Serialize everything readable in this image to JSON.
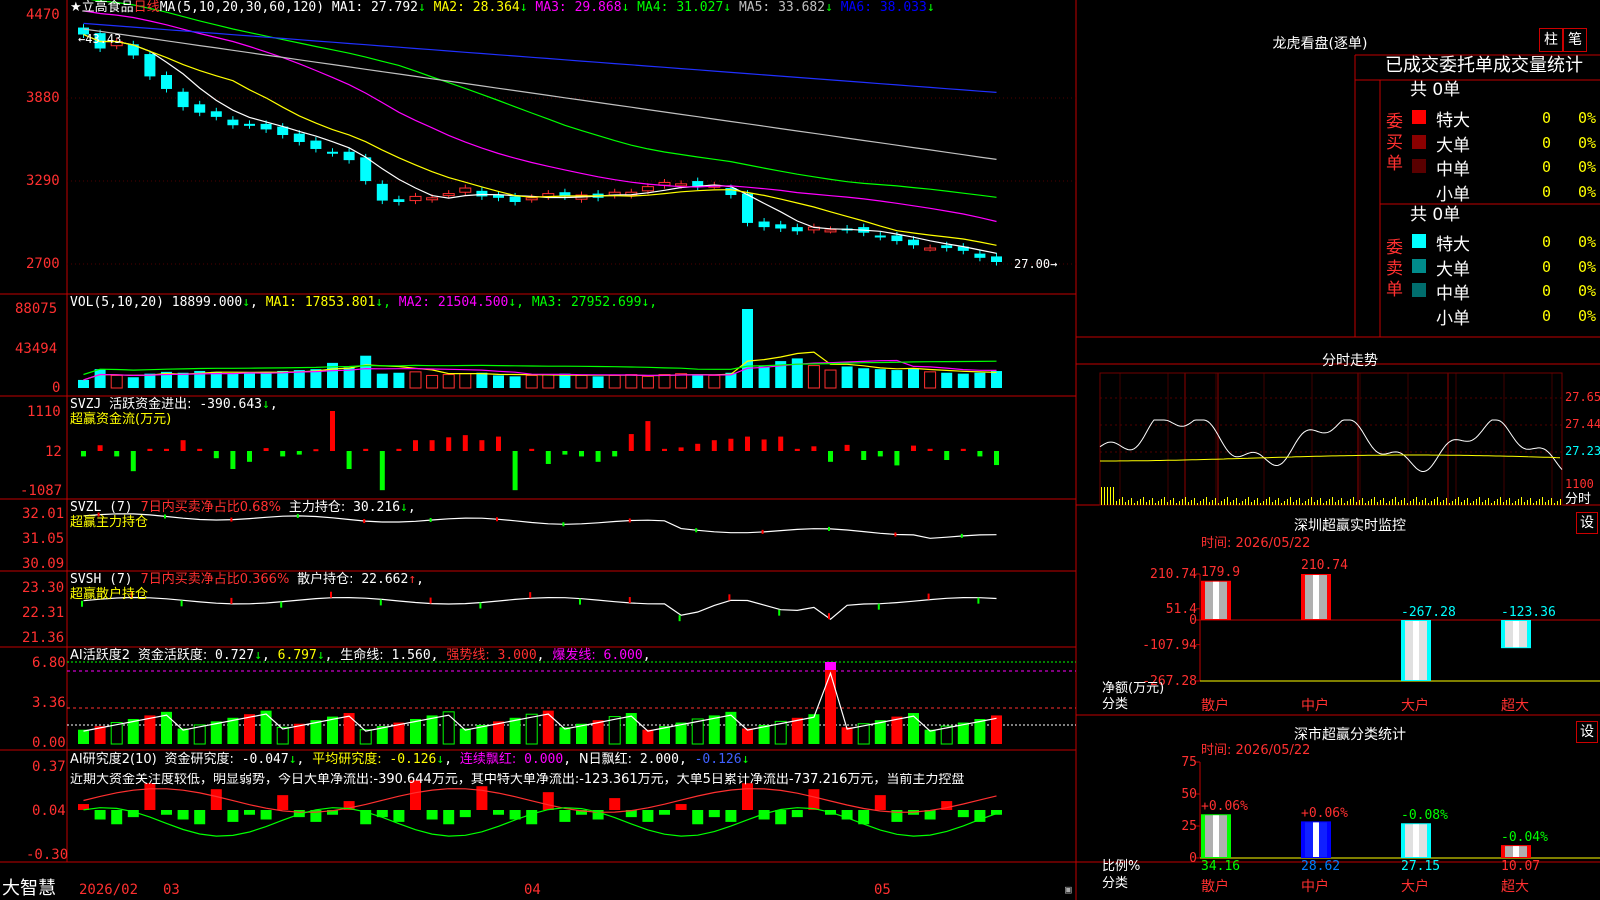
{
  "stock": {
    "name": "立高食品",
    "period": "日线",
    "ma_header": "MA(5,10,20,30,60,120)",
    "ma_values": [
      {
        "label": "MA1:",
        "value": "27.792",
        "arrow": "↓",
        "color": "#ffffff"
      },
      {
        "label": "MA2:",
        "value": "28.364",
        "arrow": "↓",
        "color": "#ffff00"
      },
      {
        "label": "MA3:",
        "value": "29.868",
        "arrow": "↓",
        "color": "#ff00ff"
      },
      {
        "label": "MA4:",
        "value": "31.027",
        "arrow": "↓",
        "color": "#00ff00"
      },
      {
        "label": "MA5:",
        "value": "33.682",
        "arrow": "↓",
        "color": "#c0c0c0"
      },
      {
        "label": "MA6:",
        "value": "38.033",
        "arrow": "↓",
        "color": "#0000ff"
      }
    ],
    "price_axis": [
      "4470",
      "3880",
      "3290",
      "2700"
    ],
    "high_label": "43.43",
    "last_label": "27.00"
  },
  "volume": {
    "header": "VOL(5,10,20)",
    "current": "18899.000",
    "ma": [
      {
        "label": "MA1:",
        "value": "17853.801",
        "color": "#ffff00"
      },
      {
        "label": "MA2:",
        "value": "21504.500",
        "color": "#ff00ff"
      },
      {
        "label": "MA3:",
        "value": "27952.699",
        "color": "#00ff00"
      }
    ],
    "axis": [
      "88075",
      "43494",
      "0"
    ]
  },
  "svzj": {
    "header": "SVZJ",
    "label": "活跃资金进出:",
    "value": "-390.643",
    "subtitle": "超赢资金流(万元)",
    "axis": [
      "1110",
      "12",
      "-1087"
    ]
  },
  "svzl": {
    "header": "SVZL (7)",
    "ratio_label": "7日内买卖净占比0.68%",
    "hold_label": "主力持仓:",
    "hold_value": "30.216",
    "subtitle": "超赢主力持仓",
    "axis": [
      "32.01",
      "31.05",
      "30.09"
    ]
  },
  "svsh": {
    "header": "SVSH (7)",
    "ratio_label": "7日内买卖净占比0.366%",
    "hold_label": "散户持仓:",
    "hold_value": "22.662",
    "subtitle": "超赢散户持仓",
    "axis": [
      "23.30",
      "22.31",
      "21.36"
    ]
  },
  "ai_active": {
    "header": "AI活跃度2",
    "a_label": "资金活跃度:",
    "a_value": "0.727",
    "b_value": "6.797",
    "life_label": "生命线:",
    "life_value": "1.560",
    "strong_label": "强势线:",
    "strong_value": "3.000",
    "burst_label": "爆发线:",
    "burst_value": "6.000",
    "axis": [
      "6.80",
      "3.36",
      "0.00"
    ]
  },
  "ai_research": {
    "header": "AI研究度2(10)",
    "a_label": "资金研究度:",
    "a_value": "-0.047",
    "b_label": "平均研究度:",
    "b_value": "-0.126",
    "c_label": "连续飘红:",
    "c_value": "0.000",
    "d_label": "N日飘红:",
    "d_value": "2.000",
    "e_value": "-0.126",
    "comment": "近期大资金关注度较低，明显弱势，今日大单净流出:-390.644万元，其中特大单净流出:-123.361万元，大单5日累计净流出-737.216万元，当前主力控盘",
    "axis": [
      "0.37",
      "0.04",
      "-0.30"
    ]
  },
  "timeline": {
    "labels": [
      "2026/02",
      "03",
      "04",
      "05"
    ]
  },
  "brand": "大智慧",
  "dragon": {
    "title": "龙虎看盘(逐单)",
    "btn1": "柱",
    "btn2": "笔",
    "subtitle": "已成交委托单成交量统计",
    "buy": {
      "label": "委买单",
      "total": "共 0单",
      "rows": [
        {
          "name": "特大",
          "count": "0",
          "pct": "0%",
          "color": "#ff0000"
        },
        {
          "name": "大单",
          "count": "0",
          "pct": "0%",
          "color": "#8b0000"
        },
        {
          "name": "中单",
          "count": "0",
          "pct": "0%",
          "color": "#5a0000"
        },
        {
          "name": "小单",
          "count": "0",
          "pct": "0%",
          "color": ""
        }
      ]
    },
    "sell": {
      "label": "委卖单",
      "total": "共 0单",
      "rows": [
        {
          "name": "特大",
          "count": "0",
          "pct": "0%",
          "color": "#00ffff"
        },
        {
          "name": "大单",
          "count": "0",
          "pct": "0%",
          "color": "#008b8b"
        },
        {
          "name": "中单",
          "count": "0",
          "pct": "0%",
          "color": "#006d6d"
        },
        {
          "name": "小单",
          "count": "0",
          "pct": "0%",
          "color": ""
        }
      ]
    }
  },
  "intraday": {
    "title": "分时走势",
    "axis": [
      "27.65",
      "27.44",
      "27.23",
      "1100"
    ],
    "label": "分时"
  },
  "monitor": {
    "title": "深圳超赢实时监控",
    "btn": "设",
    "time": "时间: 2026/05/22",
    "axis": [
      "210.74",
      "51.4",
      "0",
      "-107.94",
      "-267.28"
    ],
    "ylabel": "净额(万元)",
    "xlabel": "分类",
    "bars": [
      {
        "cat": "散户",
        "value": 179.9,
        "label": "179.9"
      },
      {
        "cat": "中户",
        "value": 210.74,
        "label": "210.74"
      },
      {
        "cat": "大户",
        "value": -267.28,
        "label": "-267.28"
      },
      {
        "cat": "超大",
        "value": -123.36,
        "label": "-123.36"
      }
    ]
  },
  "classify": {
    "title": "深市超赢分类统计",
    "btn": "设",
    "time": "时间: 2026/05/22",
    "axis": [
      "75",
      "50",
      "25",
      "0"
    ],
    "ylabel": "比例%",
    "xlabel": "分类",
    "bars": [
      {
        "cat": "散户",
        "value": 34.16,
        "label": "34.16",
        "delta": "+0.06%"
      },
      {
        "cat": "中户",
        "value": 28.62,
        "label": "28.62",
        "delta": "+0.06%"
      },
      {
        "cat": "大户",
        "value": 27.15,
        "label": "27.15",
        "delta": "-0.08%"
      },
      {
        "cat": "超大",
        "value": 10.07,
        "label": "10.07",
        "delta": "-0.04%"
      }
    ]
  },
  "chart_data": [
    {
      "type": "candlestick",
      "title": "立高食品 日线",
      "ylim": [
        27.0,
        44.7
      ],
      "close": [
        43.3,
        42.3,
        42.8,
        41.8,
        40.3,
        39.4,
        38.1,
        37.7,
        37.4,
        36.8,
        36.8,
        36.5,
        36.1,
        35.6,
        35.1,
        34.8,
        34.3,
        32.8,
        31.4,
        31.3,
        31.7,
        31.6,
        31.9,
        32.3,
        31.7,
        31.6,
        31.3,
        31.6,
        31.9,
        31.7,
        31.8,
        31.6,
        32.0,
        32.0,
        32.4,
        32.7,
        32.6,
        32.4,
        32.5,
        31.8,
        29.8,
        29.5,
        29.4,
        29.2,
        29.5,
        29.3,
        29.3,
        29.1,
        28.8,
        28.5,
        28.2,
        28.0,
        28.0,
        27.8,
        27.3,
        27.0
      ]
    },
    {
      "type": "bar",
      "title": "VOL",
      "ylim": [
        0,
        88075
      ],
      "values": [
        9000,
        21000,
        14000,
        12000,
        16000,
        18000,
        17000,
        19000,
        18000,
        16000,
        17000,
        18000,
        19000,
        20000,
        21000,
        28000,
        23000,
        36000,
        16000,
        17000,
        18000,
        14000,
        15000,
        16000,
        17000,
        14000,
        13000,
        14000,
        15000,
        16000,
        14000,
        13000,
        14000,
        15000,
        13000,
        15000,
        16000,
        15000,
        14000,
        17000,
        88075,
        24000,
        30000,
        33000,
        25000,
        20000,
        24000,
        22000,
        21000,
        20000,
        22000,
        18000,
        17000,
        16000,
        17000,
        18899
      ]
    },
    {
      "type": "bar",
      "title": "超赢资金流(万元)",
      "values": [
        0,
        -400,
        0,
        -560,
        -290,
        0,
        -700,
        0,
        -200,
        -500,
        -300,
        0,
        0,
        -100,
        0,
        0,
        -500,
        0,
        -1087,
        0,
        300,
        300,
        -300,
        0,
        300,
        -500,
        -1087,
        0,
        -360,
        -100,
        0,
        -300,
        0,
        600,
        0,
        0,
        -300,
        0,
        300,
        0,
        400,
        0,
        -280,
        0,
        0,
        -300,
        0,
        -250,
        0,
        -400,
        -250,
        0,
        -250,
        0,
        0,
        -390
      ]
    }
  ]
}
